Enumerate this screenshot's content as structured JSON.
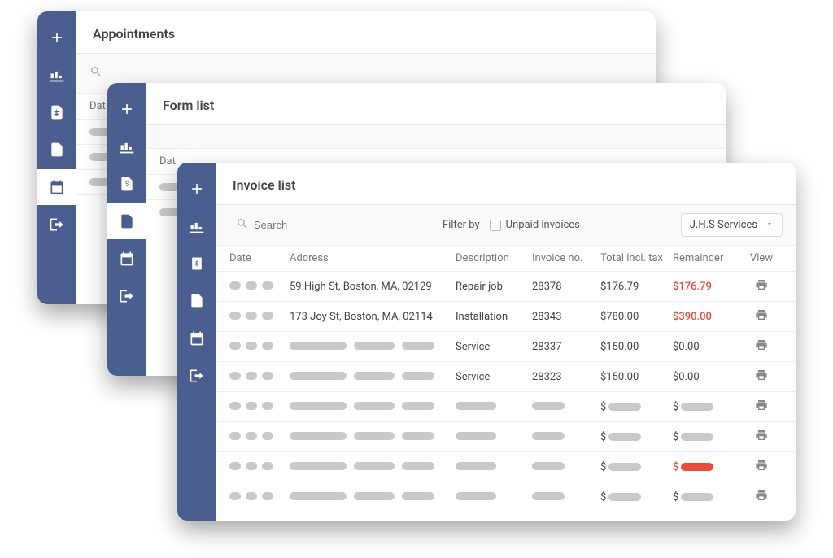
{
  "windows": {
    "appointments": {
      "title": "Appointments",
      "row_header": "Dat"
    },
    "formlist": {
      "title": "Form list",
      "row_header": "Dat"
    },
    "invoicelist": {
      "title": "Invoice list"
    }
  },
  "toolbar": {
    "search_placeholder": "Search",
    "filter_by_label": "Filter by",
    "unpaid_label": "Unpaid invoices",
    "company_selected": "J.H.S Services"
  },
  "columns": {
    "date": "Date",
    "address": "Address",
    "description": "Description",
    "invoice_no": "Invoice no.",
    "total": "Total incl. tax",
    "remainder": "Remainder",
    "view": "View"
  },
  "rows": [
    {
      "address": "59 High St, Boston, MA, 02129",
      "description": "Repair job",
      "invoice_no": "28378",
      "total": "$176.79",
      "remainder": "$176.79",
      "remainder_red": true
    },
    {
      "address": "173 Joy St, Boston, MA, 02114",
      "description": "Installation",
      "invoice_no": "28343",
      "total": "$780.00",
      "remainder": "$390.00",
      "remainder_red": true
    },
    {
      "description": "Service",
      "invoice_no": "28337",
      "total": "$150.00",
      "remainder": "$0.00",
      "remainder_red": false
    },
    {
      "description": "Service",
      "invoice_no": "28323",
      "total": "$150.00",
      "remainder": "$0.00",
      "remainder_red": false
    },
    {
      "placeholder": true,
      "remainder_red": false
    },
    {
      "placeholder": true,
      "remainder_red": false
    },
    {
      "placeholder": true,
      "remainder_red": true
    },
    {
      "placeholder": true,
      "remainder_red": false
    },
    {
      "placeholder": true,
      "remainder_red": false
    }
  ],
  "sidebar_icons": [
    "plus",
    "chart",
    "dollar-doc",
    "document",
    "calendar",
    "logout"
  ]
}
